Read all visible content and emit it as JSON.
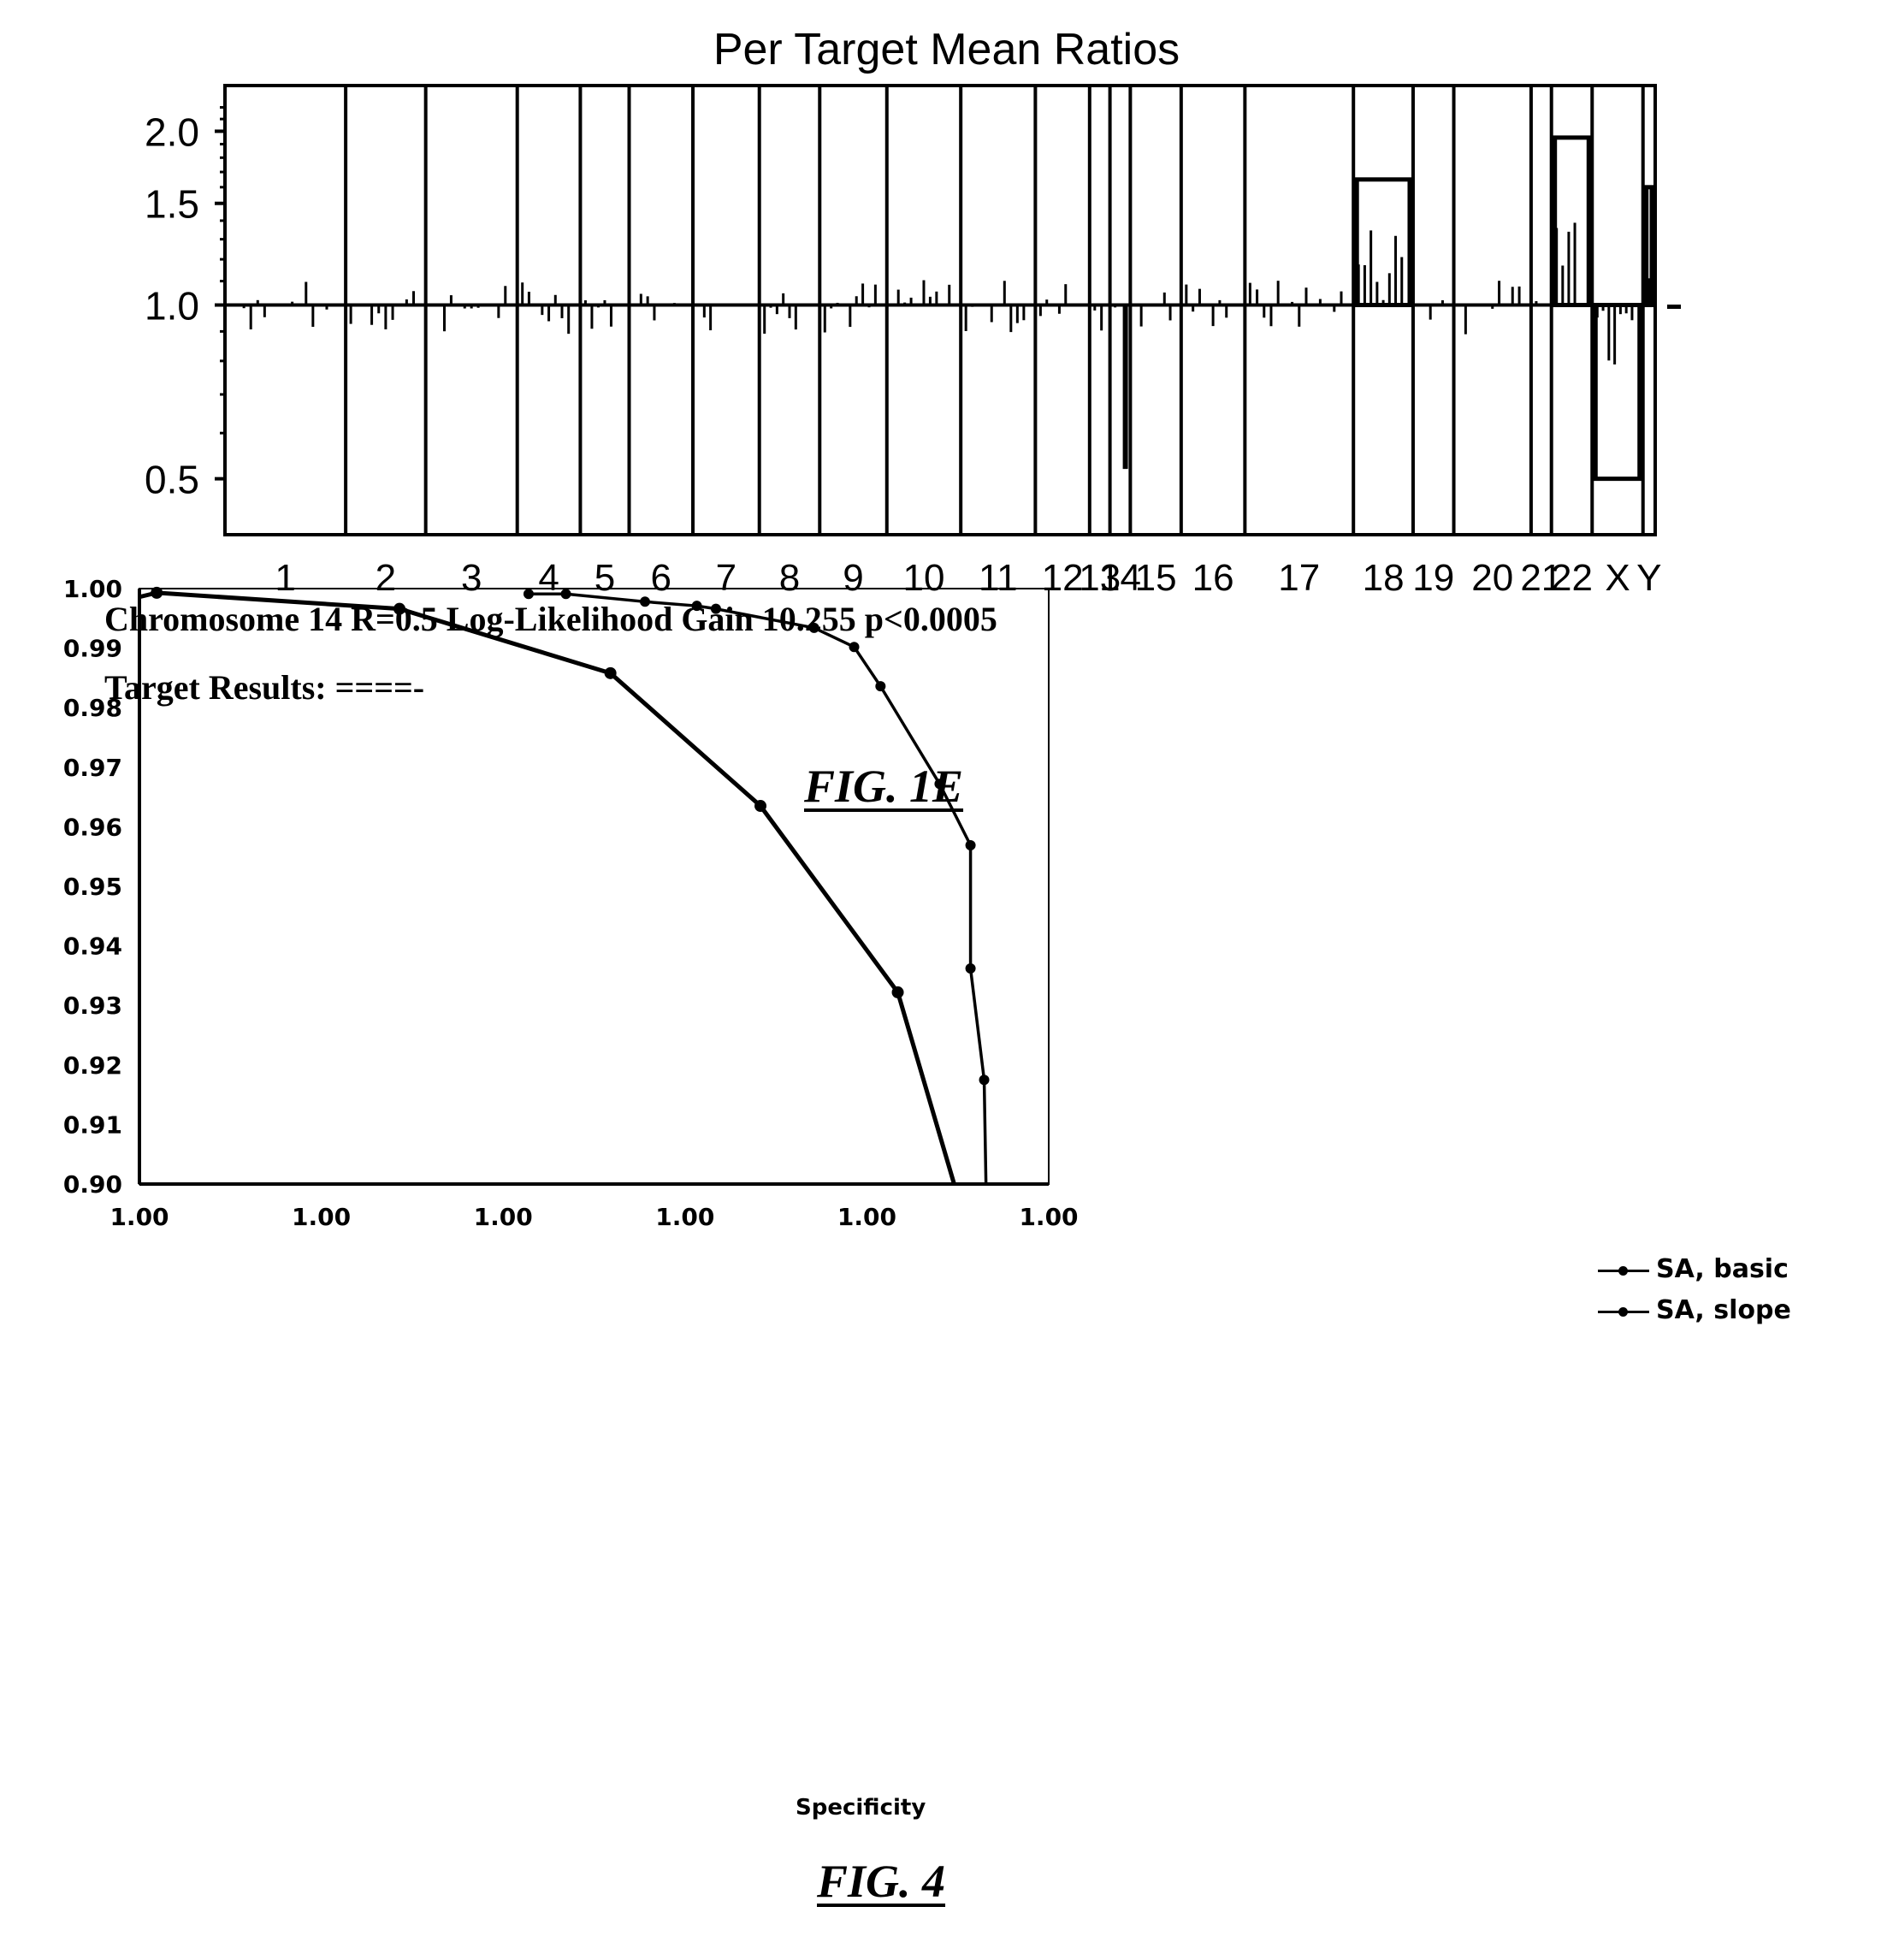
{
  "page": {
    "caption_line1": "Chromosome 14 R=0.5 Log-Likelihood Gain  10.255 p<0.0005",
    "caption_line2": "Target Results:  ====-",
    "fig1e_label": "FIG. 1E",
    "fig4_label": "FIG. 4"
  },
  "chart_data": [
    {
      "id": "fig1e",
      "type": "bar",
      "title": "Per Target Mean Ratios",
      "xlabel": "",
      "ylabel": "",
      "yscale": "log",
      "ylim": [
        0.4,
        2.4
      ],
      "yticks": [
        0.5,
        1.0,
        1.5,
        2.0
      ],
      "ytick_labels": [
        "0.5",
        "1.0",
        "1.5",
        "2.0"
      ],
      "baseline": 1.0,
      "categories": [
        "1",
        "2",
        "3",
        "4",
        "5",
        "6",
        "7",
        "8",
        "9",
        "10",
        "11",
        "12",
        "13",
        "14",
        "15",
        "16",
        "17",
        "18",
        "19",
        "20",
        "21",
        "22",
        "X",
        "Y"
      ],
      "segment_means": [
        {
          "chromosome": "1",
          "ratio": 1.0
        },
        {
          "chromosome": "2",
          "ratio": 1.0
        },
        {
          "chromosome": "3",
          "ratio": 1.0
        },
        {
          "chromosome": "4",
          "ratio": 1.0
        },
        {
          "chromosome": "5",
          "ratio": 1.0
        },
        {
          "chromosome": "6",
          "ratio": 1.0
        },
        {
          "chromosome": "7",
          "ratio": 1.0
        },
        {
          "chromosome": "8",
          "ratio": 1.0
        },
        {
          "chromosome": "9",
          "ratio": 1.0
        },
        {
          "chromosome": "10",
          "ratio": 1.0
        },
        {
          "chromosome": "11",
          "ratio": 1.0
        },
        {
          "chromosome": "12",
          "ratio": 1.0
        },
        {
          "chromosome": "13",
          "ratio": 1.0
        },
        {
          "chromosome": "14",
          "ratio": 1.0
        },
        {
          "chromosome": "15",
          "ratio": 1.0
        },
        {
          "chromosome": "16",
          "ratio": 1.0
        },
        {
          "chromosome": "17",
          "ratio": 1.0
        },
        {
          "chromosome": "18",
          "ratio": 1.65
        },
        {
          "chromosome": "19",
          "ratio": 1.0
        },
        {
          "chromosome": "20",
          "ratio": 1.0
        },
        {
          "chromosome": "21",
          "ratio": 1.0
        },
        {
          "chromosome": "22",
          "ratio": 1.95
        },
        {
          "chromosome": "X",
          "ratio": 0.5
        },
        {
          "chromosome": "Y",
          "ratio": 1.6
        }
      ],
      "chromosome_widths": [
        1.78,
        1.18,
        1.35,
        0.93,
        0.72,
        0.94,
        0.98,
        0.89,
        0.99,
        1.09,
        1.1,
        0.8,
        0.3,
        0.3,
        0.75,
        0.94,
        1.6,
        0.88,
        0.6,
        1.14,
        0.3,
        0.6,
        0.75,
        0.18
      ],
      "notable_targets": [
        {
          "chromosome": "14",
          "ratio": 0.52,
          "note": "single deep dip"
        },
        {
          "chromosome": "18",
          "ratio": 1.35,
          "note": "elevated targets within gain box"
        },
        {
          "chromosome": "22",
          "ratio": 1.55,
          "note": "elevated targets within gain box"
        },
        {
          "chromosome": "X",
          "ratio": 0.58,
          "note": "depressed targets within loss box"
        }
      ]
    },
    {
      "id": "fig4",
      "type": "line",
      "title": "",
      "xlabel": "Specificity",
      "ylabel": "",
      "xlim": [
        0,
        1
      ],
      "ylim": [
        0.9,
        1.0
      ],
      "x_tick_positions": [
        0,
        0.2,
        0.4,
        0.6,
        0.8,
        1.0
      ],
      "x_tick_labels": [
        "1.00",
        "1.00",
        "1.00",
        "1.00",
        "1.00",
        "1.00"
      ],
      "yticks": [
        1.0,
        0.99,
        0.98,
        0.97,
        0.96,
        0.95,
        0.94,
        0.93,
        0.92,
        0.91,
        0.9
      ],
      "ytick_labels": [
        "1.00",
        "0.99",
        "0.98",
        "0.97",
        "0.96",
        "0.95",
        "0.94",
        "0.93",
        "0.92",
        "0.91",
        "0.90"
      ],
      "grid": false,
      "legend_position": "right",
      "series": [
        {
          "name": "SA, basic",
          "x": [
            0.0,
            0.019,
            0.286,
            0.518,
            0.683,
            0.834,
            0.896
          ],
          "y": [
            0.9986,
            0.9993,
            0.9966,
            0.9858,
            0.9635,
            0.9322,
            0.9
          ],
          "markers": [
            false,
            true,
            true,
            true,
            true,
            true,
            false
          ]
        },
        {
          "name": "SA, slope",
          "x": [
            0.428,
            0.469,
            0.556,
            0.613,
            0.634,
            0.742,
            0.786,
            0.815,
            0.88,
            0.914,
            0.914,
            0.929,
            0.931
          ],
          "y": [
            0.9991,
            0.9991,
            0.9978,
            0.9971,
            0.9966,
            0.9934,
            0.9902,
            0.9836,
            0.9672,
            0.9569,
            0.9362,
            0.9175,
            0.9
          ],
          "markers": [
            true,
            true,
            true,
            true,
            true,
            true,
            true,
            true,
            true,
            true,
            true,
            true,
            false
          ]
        }
      ]
    }
  ]
}
